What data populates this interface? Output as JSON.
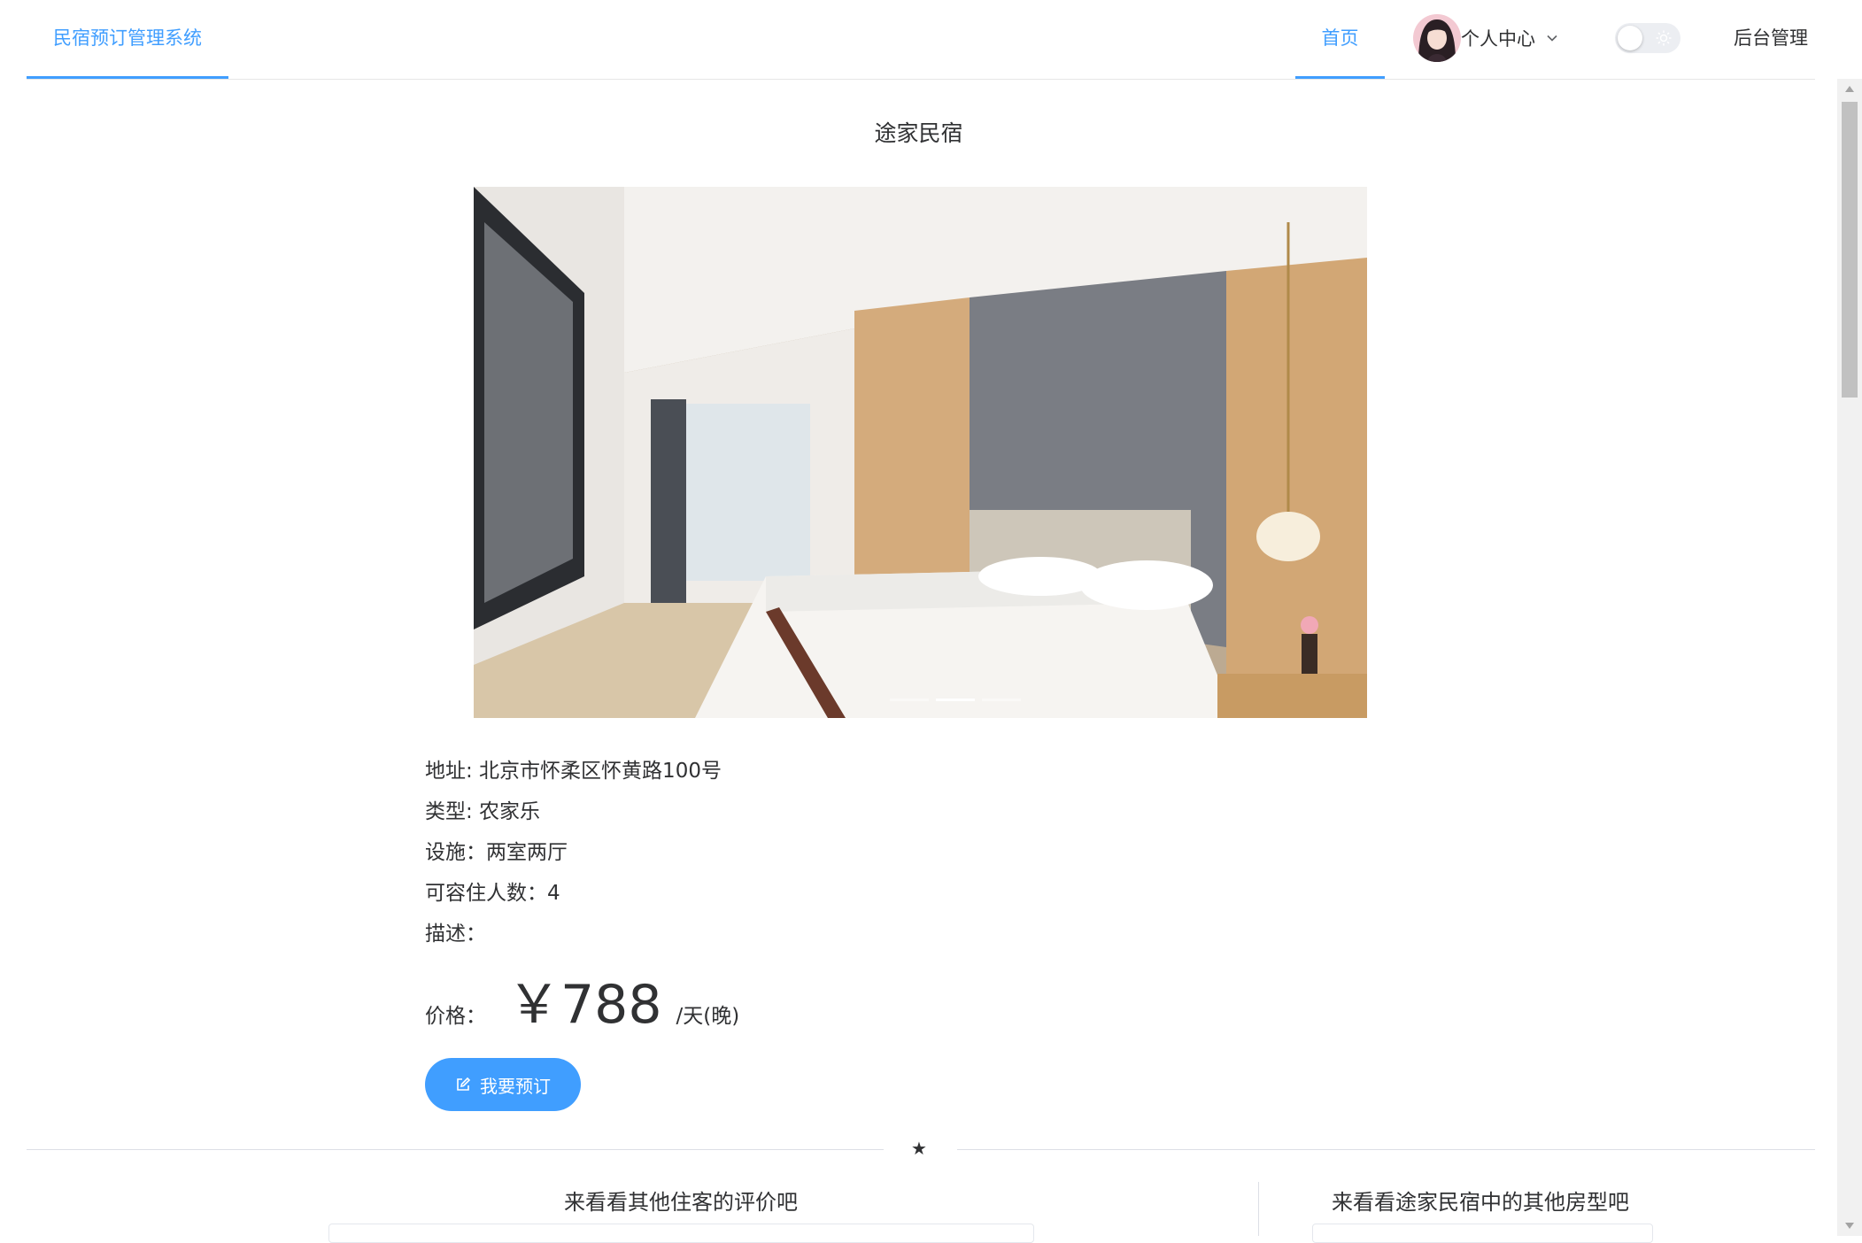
{
  "header": {
    "brand": "民宿预订管理系统",
    "nav_home": "首页",
    "nav_user": "个人中心",
    "nav_admin": "后台管理"
  },
  "homestay": {
    "name": "途家民宿",
    "address": "地址: 北京市怀柔区怀黄路100号",
    "type": "类型: 农家乐",
    "facilities": "设施：两室两厅",
    "capacity": "可容住人数：4",
    "description": "描述："
  },
  "price": {
    "label": "价格：",
    "amount": "￥788",
    "unit": "/天(晚)"
  },
  "book_button": "我要预订",
  "carousel": {
    "slides": 3,
    "active": 2
  },
  "sections": {
    "reviews_title": "来看看其他住客的评价吧",
    "rooms_title": "来看看途家民宿中的其他房型吧"
  },
  "colors": {
    "accent": "#409eff",
    "text": "#303133",
    "border": "#e6e6e6"
  }
}
